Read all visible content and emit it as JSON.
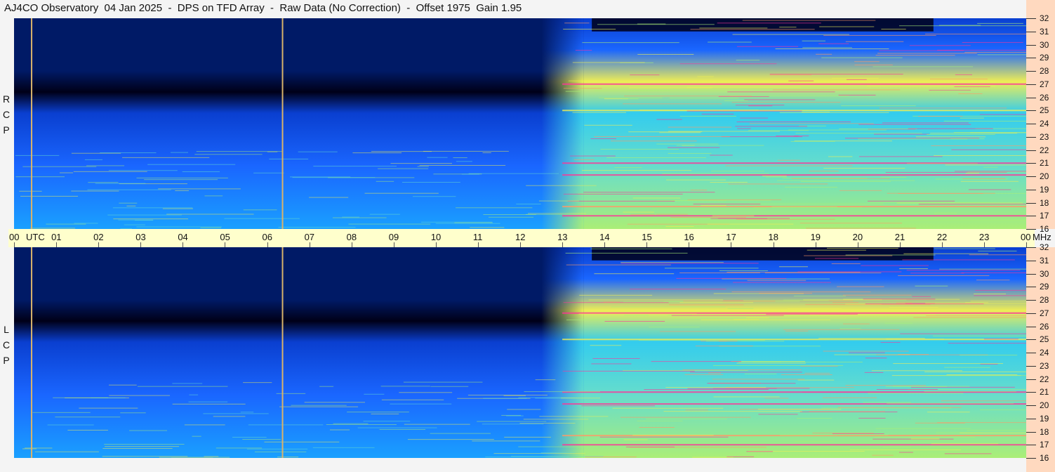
{
  "title": "AJ4CO Observatory  04 Jan 2025  -  DPS on TFD Array  -  Raw Data (No Correction)  -  Offset 1975  Gain 1.95",
  "panels": [
    {
      "id": "rcp",
      "letters": [
        "R",
        "C",
        "P"
      ]
    },
    {
      "id": "lcp",
      "letters": [
        "L",
        "C",
        "P"
      ]
    }
  ],
  "chart_data": {
    "type": "heatmap",
    "title": "AJ4CO Observatory  04 Jan 2025  -  DPS on TFD Array  -  Raw Data (No Correction)  -  Offset 1975  Gain 1.95",
    "x_axis": {
      "unit_label": "UTC",
      "range": [
        0,
        24
      ],
      "tick_labels": [
        "00",
        "01",
        "02",
        "03",
        "04",
        "05",
        "06",
        "07",
        "08",
        "09",
        "10",
        "11",
        "12",
        "13",
        "14",
        "15",
        "16",
        "17",
        "18",
        "19",
        "20",
        "21",
        "22",
        "23",
        "00"
      ]
    },
    "y_axis": {
      "unit_label": "MHz",
      "range": [
        16,
        32
      ],
      "tick_labels": [
        "32",
        "31",
        "30",
        "29",
        "28",
        "27",
        "26",
        "25",
        "24",
        "23",
        "22",
        "21",
        "20",
        "19",
        "18",
        "17",
        "16"
      ]
    },
    "series": [
      {
        "name": "RCP"
      },
      {
        "name": "LCP"
      }
    ],
    "colormap": [
      "#000018",
      "#001a66",
      "#0a3fd0",
      "#1a66ff",
      "#1aa0ff",
      "#33ccee",
      "#66ddcc",
      "#aaee77",
      "#eeee55",
      "#ff9966",
      "#ff3399"
    ],
    "features": {
      "vertical_marker_lines_utc": [
        0.4,
        6.35
      ],
      "daytime_onset_utc": 13.0,
      "dark_region_utc": [
        13.7,
        21.8
      ],
      "persistent_bands_mhz": [
        27.0,
        25.0,
        21.0,
        20.1,
        17.7,
        17.0
      ]
    }
  }
}
